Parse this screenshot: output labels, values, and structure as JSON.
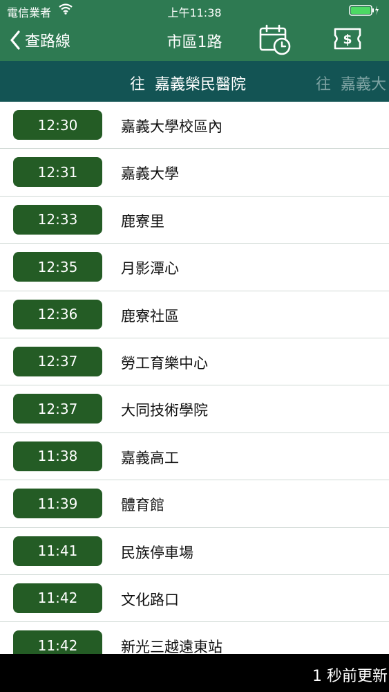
{
  "status_bar": {
    "carrier": "電信業者",
    "time": "上午11:38"
  },
  "nav": {
    "back_label": "查路線",
    "title": "市區1路"
  },
  "directions": [
    {
      "prefix": "往",
      "name": "嘉義榮民醫院"
    },
    {
      "prefix": "往",
      "name": "嘉義大"
    }
  ],
  "stops": [
    {
      "time": "12:30",
      "name": "嘉義大學校區內"
    },
    {
      "time": "12:31",
      "name": "嘉義大學"
    },
    {
      "time": "12:33",
      "name": "鹿寮里"
    },
    {
      "time": "12:35",
      "name": "月影潭心"
    },
    {
      "time": "12:36",
      "name": "鹿寮社區"
    },
    {
      "time": "12:37",
      "name": "勞工育樂中心"
    },
    {
      "time": "12:37",
      "name": "大同技術學院"
    },
    {
      "time": "11:38",
      "name": "嘉義高工"
    },
    {
      "time": "11:39",
      "name": "體育館"
    },
    {
      "time": "11:41",
      "name": "民族停車場"
    },
    {
      "time": "11:42",
      "name": "文化路口"
    },
    {
      "time": "11:42",
      "name": "新光三越遠東站"
    }
  ],
  "footer": {
    "update_text": "1 秒前更新"
  },
  "colors": {
    "header": "#2e7a52",
    "direction_bar": "#135454",
    "time_pill": "#245c25",
    "footer": "#000000"
  }
}
